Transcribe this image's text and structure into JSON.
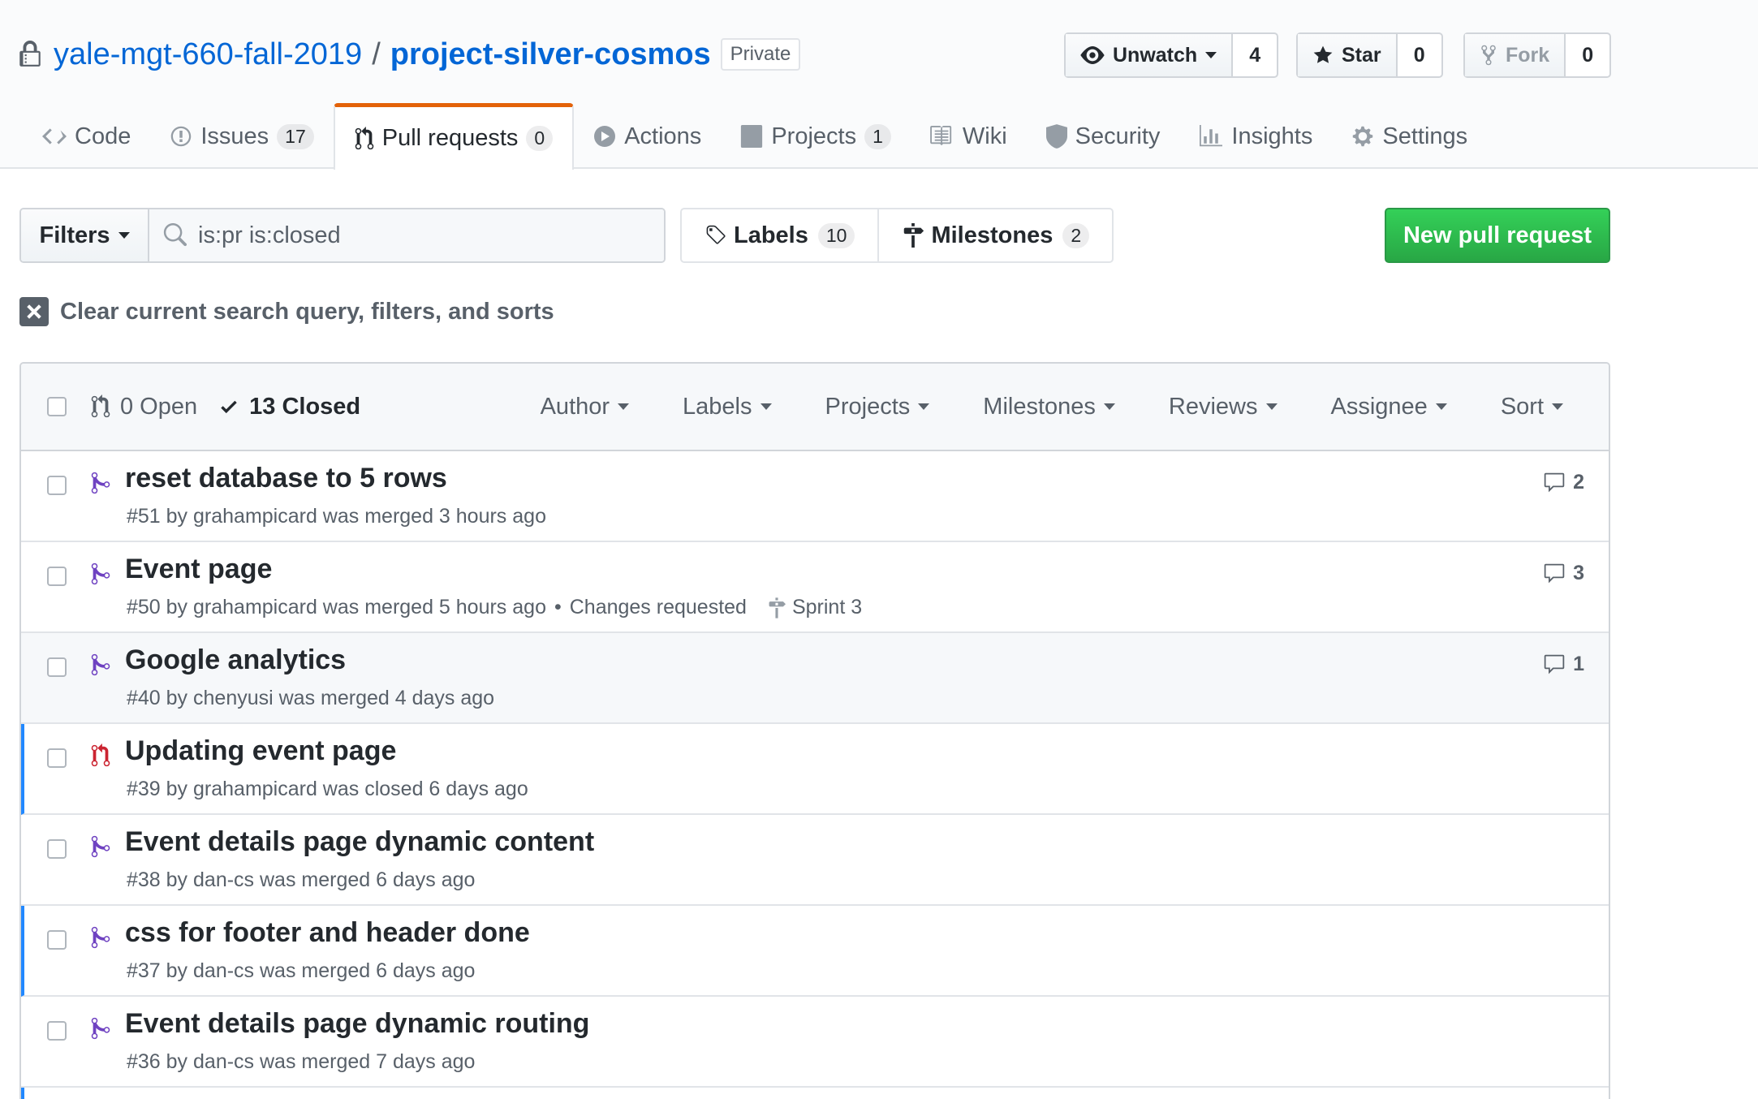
{
  "repo": {
    "owner": "yale-mgt-660-fall-2019",
    "separator": "/",
    "name": "project-silver-cosmos",
    "visibility": "Private"
  },
  "social": {
    "watch_label": "Unwatch",
    "watch_count": "4",
    "star_label": "Star",
    "star_count": "0",
    "fork_label": "Fork",
    "fork_count": "0"
  },
  "nav": {
    "code": "Code",
    "issues": "Issues",
    "issues_count": "17",
    "pulls": "Pull requests",
    "pulls_count": "0",
    "actions": "Actions",
    "projects": "Projects",
    "projects_count": "1",
    "wiki": "Wiki",
    "security": "Security",
    "insights": "Insights",
    "settings": "Settings"
  },
  "subnav": {
    "filters_label": "Filters",
    "search_value": "is:pr is:closed",
    "labels_label": "Labels",
    "labels_count": "10",
    "milestones_label": "Milestones",
    "milestones_count": "2",
    "new_pr_label": "New pull request",
    "clear_query": "Clear current search query, filters, and sorts"
  },
  "list_header": {
    "open_label": "0 Open",
    "closed_label": "13 Closed",
    "filters": [
      "Author",
      "Labels",
      "Projects",
      "Milestones",
      "Reviews",
      "Assignee",
      "Sort"
    ]
  },
  "pull_requests": [
    {
      "title": "reset database to 5 rows",
      "meta": "#51 by grahampicard was merged 3 hours ago",
      "extra": "",
      "milestone": "",
      "comments": "2",
      "state": "merged"
    },
    {
      "title": "Event page",
      "meta": "#50 by grahampicard was merged 5 hours ago",
      "extra": "Changes requested",
      "milestone": "Sprint 3",
      "comments": "3",
      "state": "merged"
    },
    {
      "title": "Google analytics",
      "meta": "#40 by chenyusi was merged 4 days ago",
      "extra": "",
      "milestone": "",
      "comments": "1",
      "state": "merged"
    },
    {
      "title": "Updating event page",
      "meta": "#39 by grahampicard was closed 6 days ago",
      "extra": "",
      "milestone": "",
      "comments": "",
      "state": "closed"
    },
    {
      "title": "Event details page dynamic content",
      "meta": "#38 by dan-cs was merged 6 days ago",
      "extra": "",
      "milestone": "",
      "comments": "",
      "state": "merged"
    },
    {
      "title": "css for footer and header done",
      "meta": "#37 by dan-cs was merged 6 days ago",
      "extra": "",
      "milestone": "",
      "comments": "",
      "state": "merged"
    },
    {
      "title": "Event details page dynamic routing",
      "meta": "#36 by dan-cs was merged 7 days ago",
      "extra": "",
      "milestone": "",
      "comments": "",
      "state": "merged"
    }
  ],
  "colors": {
    "link": "#0366d6",
    "merged": "#6f42c1",
    "closed": "#cb2431",
    "primary_button": "#28a745",
    "selected_tab_accent": "#e36209",
    "unread_marker": "#2188ff"
  }
}
